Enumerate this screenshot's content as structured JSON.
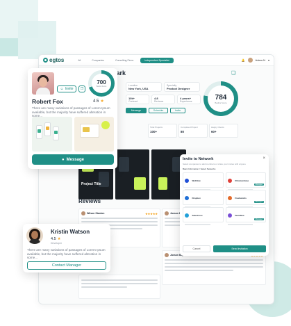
{
  "app": {
    "brand": "egtos",
    "tabs": [
      "All",
      "Companies",
      "Consulting Firms",
      "Independent Specialist"
    ],
    "user_name": "Adam.N"
  },
  "profile": {
    "name": "Gregory Clark",
    "role": "UX/UI Designer",
    "location_label": "Location",
    "location": "New York, USA",
    "specialty_label": "Specialty",
    "specialty": "Product Designer",
    "stats": [
      {
        "value": "10k+",
        "label": "Contract"
      },
      {
        "value": "4.8",
        "label": "Reviews"
      },
      {
        "value": "4 years+",
        "label": "Experience"
      }
    ],
    "message_label": "Message",
    "schedule_label": "Schedule",
    "invite_label": "Invite",
    "score": "784",
    "score_label": "Badira Score",
    "score_fraction": 0.78,
    "project_stats": [
      {
        "label": "Total Projects",
        "value": "100+"
      },
      {
        "label": "Completed Project",
        "value": "80"
      },
      {
        "label": "Happy Clients",
        "value": "60+"
      }
    ]
  },
  "project": {
    "title": "Project Title"
  },
  "reviews": {
    "heading": "Reviews",
    "items": [
      {
        "name": "Wilson Stanton",
        "stars": "★★★★★"
      },
      {
        "name": "Jaxson Baptista",
        "stars": "★★★★★"
      },
      {
        "name": "Jaxson Baptista",
        "stars": "★★★★★"
      },
      {
        "name": "Jaxson Baptista",
        "stars": "★★★★★"
      }
    ]
  },
  "robert_card": {
    "name": "Robert Fox",
    "rating": "4.5",
    "score": "700",
    "score_label": "Badira Score",
    "score_fraction": 0.7,
    "invite_label": "Invite",
    "description": "There are many variations of passages of Lorem Ipsum available, but the majority have suffered alteration in some...",
    "message_label": "Message"
  },
  "kristin_card": {
    "name": "Kristin Watson",
    "rating": "4.5",
    "role": "Developer",
    "description": "There are many variations of passages of Lorem Ipsum available, but the majority have suffered alteration in some...",
    "contact_label": "Contact Manager"
  },
  "invite_modal": {
    "title": "Invite to Network",
    "subtitle": "Select companies to add members or share your invites with anyone",
    "section": "Basic Information / Select Networks",
    "companies": [
      {
        "name": "Webflow",
        "color": "#1f4fd6",
        "tag": ""
      },
      {
        "name": "Ultramundane",
        "color": "#e0413a",
        "tag": "Managed"
      },
      {
        "name": "Dropbox",
        "color": "#1f6fd6",
        "tag": ""
      },
      {
        "name": "Freshworks",
        "color": "#e36b2a",
        "tag": "Managed"
      },
      {
        "name": "Salesforce",
        "color": "#21a0d8",
        "tag": ""
      },
      {
        "name": "Teamflow",
        "color": "#7a4fd6",
        "tag": "Managed"
      }
    ],
    "cancel_label": "Cancel",
    "send_label": "Send Invitation"
  },
  "colors": {
    "accent": "#1f8f86",
    "star": "#f5a623"
  }
}
